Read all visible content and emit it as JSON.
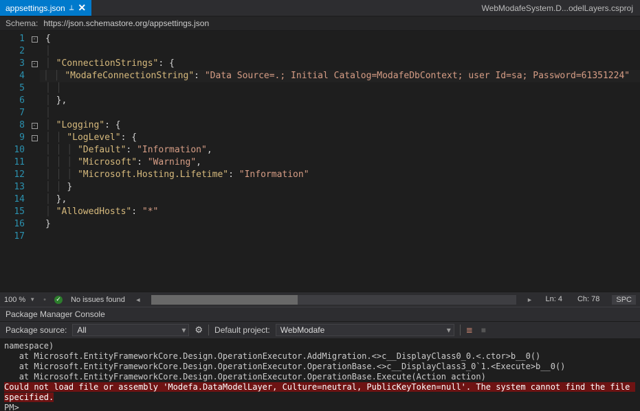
{
  "tab": {
    "filename": "appsettings.json",
    "close_glyph": "✕"
  },
  "project_label": "WebModafeSystem.D...odelLayers.csproj",
  "schema": {
    "label": "Schema:",
    "url": "https://json.schemastore.org/appsettings.json"
  },
  "editor_lines": {
    "l1": "{",
    "l3_key": "\"ConnectionStrings\"",
    "l3_rest": ": {",
    "l4_key": "\"ModafeConnectionString\"",
    "l4_mid": ": ",
    "l4_val": "\"Data Source=.; Initial Catalog=ModafeDbContext; user Id=sa; Password=61351224\"",
    "l6": "},",
    "l8_key": "\"Logging\"",
    "l8_rest": ": {",
    "l9_key": "\"LogLevel\"",
    "l9_rest": ": {",
    "l10_key": "\"Default\"",
    "l10_val": "\"Information\"",
    "l11_key": "\"Microsoft\"",
    "l11_val": "\"Warning\"",
    "l12_key": "\"Microsoft.Hosting.Lifetime\"",
    "l12_val": "\"Information\"",
    "l13": "}",
    "l14": "},",
    "l15_key": "\"AllowedHosts\"",
    "l15_val": "\"*\"",
    "l16": "}"
  },
  "status": {
    "zoom": "100 %",
    "issues": "No issues found",
    "line": "Ln: 4",
    "col": "Ch: 78",
    "spc": "SPC"
  },
  "panel_title": "Package Manager Console",
  "toolbar": {
    "source_label": "Package source:",
    "source_value": "All",
    "project_label": "Default project:",
    "project_value": "WebModafe"
  },
  "console": {
    "l0": "namespace)",
    "l1": "   at Microsoft.EntityFrameworkCore.Design.OperationExecutor.AddMigration.<>c__DisplayClass0_0.<.ctor>b__0()",
    "l2": "   at Microsoft.EntityFrameworkCore.Design.OperationExecutor.OperationBase.<>c__DisplayClass3_0`1.<Execute>b__0()",
    "l3": "   at Microsoft.EntityFrameworkCore.Design.OperationExecutor.OperationBase.Execute(Action action)",
    "err": "Could not load file or assembly 'Modefa.DataModelLayer, Culture=neutral, PublicKeyToken=null'. The system cannot find the file specified.",
    "prompt": "PM>"
  }
}
